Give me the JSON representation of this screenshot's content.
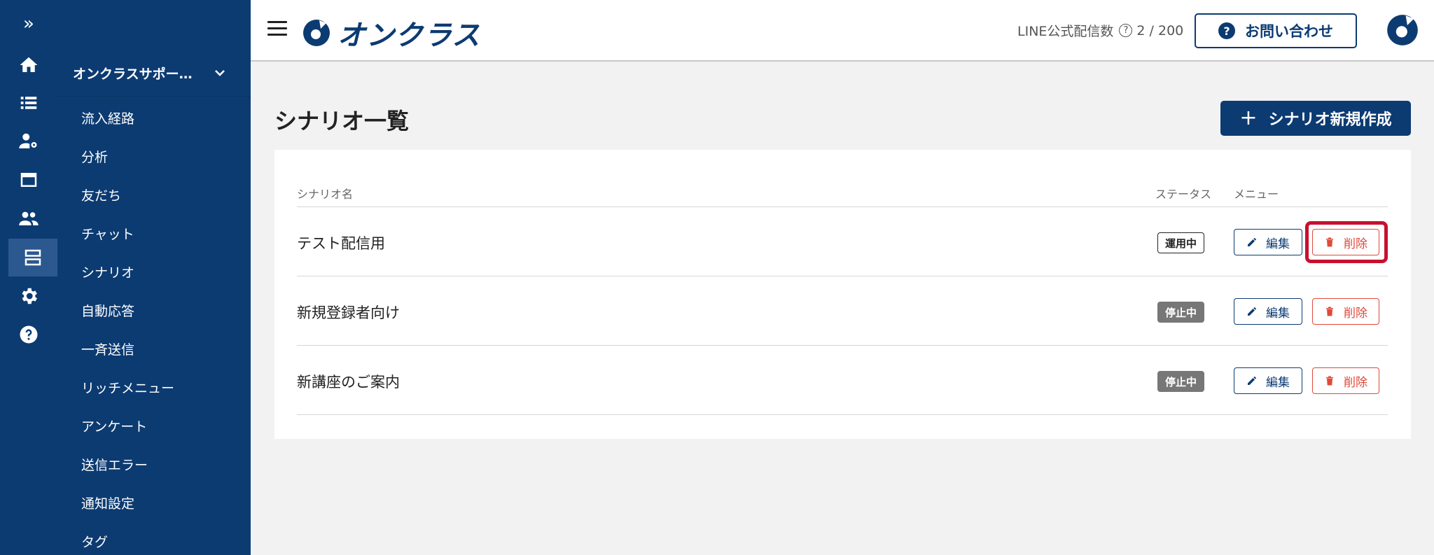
{
  "rail": {
    "expand_glyph": "»",
    "items": [
      {
        "icon": "home-icon"
      },
      {
        "icon": "list-icon"
      },
      {
        "icon": "user-settings-icon"
      },
      {
        "icon": "window-icon"
      },
      {
        "icon": "people-icon"
      },
      {
        "icon": "scenario-icon",
        "active": true
      },
      {
        "icon": "gear-icon"
      },
      {
        "icon": "help-icon"
      }
    ]
  },
  "sidebar": {
    "account": "オンクラスサポー…",
    "items": [
      {
        "label": "流入経路"
      },
      {
        "label": "分析"
      },
      {
        "label": "友だち"
      },
      {
        "label": "チャット"
      },
      {
        "label": "シナリオ"
      },
      {
        "label": "自動応答"
      },
      {
        "label": "一斉送信"
      },
      {
        "label": "リッチメニュー"
      },
      {
        "label": "アンケート"
      },
      {
        "label": "送信エラー"
      },
      {
        "label": "通知設定"
      },
      {
        "label": "タグ"
      }
    ]
  },
  "header": {
    "logo_text": "オンクラス",
    "quota_label": "LINE公式配信数",
    "quota_help": "?",
    "quota_value": "2 / 200",
    "contact_icon": "?",
    "contact_label": "お問い合わせ"
  },
  "main": {
    "title": "シナリオ一覧",
    "create_plus": "+",
    "create_label": "シナリオ新規作成",
    "table": {
      "col_name": "シナリオ名",
      "col_status": "ステータス",
      "col_menu": "メニュー",
      "rows": [
        {
          "name": "テスト配信用",
          "status": "運用中",
          "edit": "編集",
          "delete": "削除"
        },
        {
          "name": "新規登録者向け",
          "status": "停止中",
          "edit": "編集",
          "delete": "削除"
        },
        {
          "name": "新講座のご案内",
          "status": "停止中",
          "edit": "編集",
          "delete": "削除"
        }
      ]
    }
  },
  "colors": {
    "brand": "#0c3b72",
    "danger": "#e04a3a",
    "highlight": "#c8102e",
    "stopped_badge": "#777777"
  }
}
